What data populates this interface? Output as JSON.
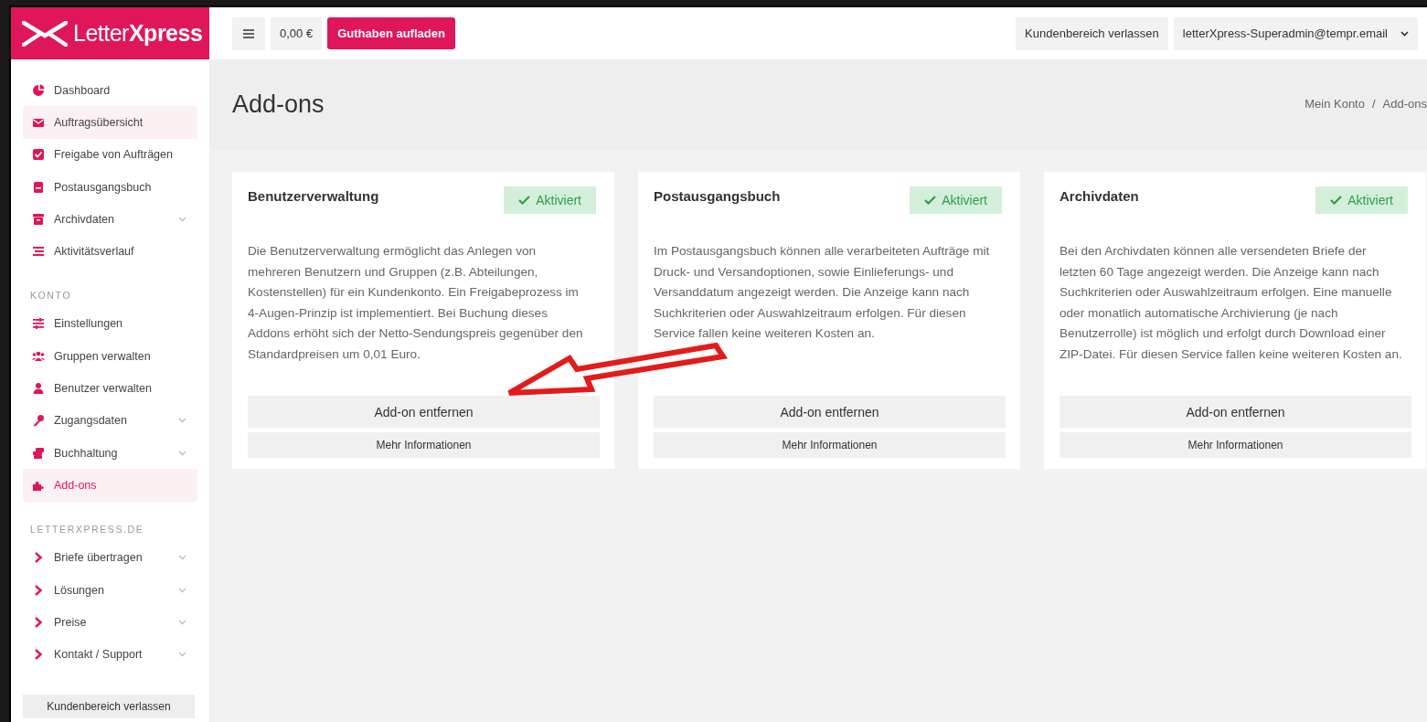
{
  "brand": {
    "light": "Letter",
    "bold": "Xpress"
  },
  "topbar": {
    "balance": "0,00 €",
    "topup_button": "Guthaben aufladen",
    "leave_button": "Kundenbereich verlassen",
    "user_menu": "letterXpress-Superadmin@tempr.email"
  },
  "sidebar": {
    "sections": [
      {
        "items": [
          {
            "label": "Dashboard",
            "selected": false,
            "hovered": false,
            "expandable": false
          },
          {
            "label": "Auftragsübersicht",
            "selected": false,
            "hovered": true,
            "expandable": false
          },
          {
            "label": "Freigabe von Aufträgen",
            "selected": false,
            "hovered": false,
            "expandable": false
          },
          {
            "label": "Postausgangsbuch",
            "selected": false,
            "hovered": false,
            "expandable": false
          },
          {
            "label": "Archivdaten",
            "selected": false,
            "hovered": false,
            "expandable": true
          },
          {
            "label": "Aktivitätsverlauf",
            "selected": false,
            "hovered": false,
            "expandable": false
          }
        ]
      },
      {
        "heading": "KONTO",
        "items": [
          {
            "label": "Einstellungen",
            "selected": false,
            "hovered": false,
            "expandable": false
          },
          {
            "label": "Gruppen verwalten",
            "selected": false,
            "hovered": false,
            "expandable": false
          },
          {
            "label": "Benutzer verwalten",
            "selected": false,
            "hovered": false,
            "expandable": false
          },
          {
            "label": "Zugangsdaten",
            "selected": false,
            "hovered": false,
            "expandable": true
          },
          {
            "label": "Buchhaltung",
            "selected": false,
            "hovered": false,
            "expandable": true
          },
          {
            "label": "Add-ons",
            "selected": true,
            "hovered": false,
            "expandable": false
          }
        ]
      },
      {
        "heading": "LETTERXPRESS.DE",
        "items": [
          {
            "label": "Briefe übertragen",
            "selected": false,
            "hovered": false,
            "expandable": true
          },
          {
            "label": "Lösungen",
            "selected": false,
            "hovered": false,
            "expandable": true
          },
          {
            "label": "Preise",
            "selected": false,
            "hovered": false,
            "expandable": true
          },
          {
            "label": "Kontakt / Support",
            "selected": false,
            "hovered": false,
            "expandable": true
          }
        ]
      }
    ],
    "leave_button": "Kundenbereich verlassen"
  },
  "page": {
    "title": "Add-ons",
    "breadcrumb": [
      "Mein Konto",
      "Add-ons"
    ],
    "breadcrumb_separator": "/"
  },
  "addons": [
    {
      "title": "Benutzerverwaltung",
      "status": "Aktiviert",
      "active": true,
      "description": "Die Benutzerverwaltung ermöglicht das Anlegen von mehreren Benutzern und Gruppen (z.B. Abteilungen, Kostenstellen) für ein Kundenkonto. Ein Freigabeprozess im 4-Augen-Prinzip ist implementiert. Bei Buchung dieses Addons erhöht sich der Netto-Sendungspreis gegenüber den Standardpreisen um 0,01 Euro.",
      "remove_button": "Add-on entfernen",
      "info_button": "Mehr Informationen"
    },
    {
      "title": "Postausgangsbuch",
      "status": "Aktiviert",
      "active": true,
      "description": "Im Postausgangsbuch können alle verarbeiteten Aufträge mit Druck- und Versandoptionen, sowie Einlieferungs- und Versanddatum angezeigt werden. Die Anzeige kann nach Suchkriterien oder Auswahlzeitraum erfolgen. Für diesen Service fallen keine weiteren Kosten an.",
      "remove_button": "Add-on entfernen",
      "info_button": "Mehr Informationen"
    },
    {
      "title": "Archivdaten",
      "status": "Aktiviert",
      "active": true,
      "description": "Bei den Archivdaten können alle versendeten Briefe der letzten 60 Tage angezeigt werden. Die Anzeige kann nach Suchkriterien oder Auswahlzeitraum erfolgen. Eine manuelle oder monatlich automatische Archivierung (je nach Benutzerrolle) ist möglich und erfolgt durch Download einer ZIP-Datei. Für diesen Service fallen keine weiteren Kosten an.",
      "remove_button": "Add-on entfernen",
      "info_button": "Mehr Informationen"
    }
  ]
}
